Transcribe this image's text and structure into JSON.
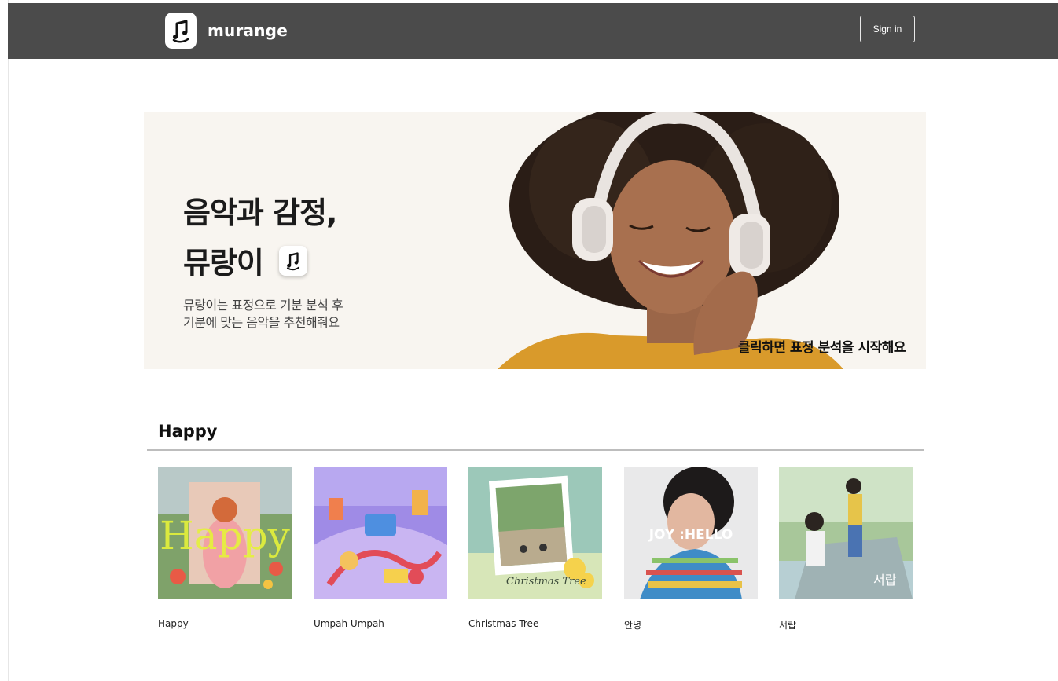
{
  "header": {
    "brand": "murange",
    "signin_label": "Sign in"
  },
  "hero": {
    "title_line1": "음악과 감정,",
    "title_line2": "뮤랑이",
    "desc_line1": "뮤랑이는 표정으로 기분 분석 후",
    "desc_line2": "기분에 맞는 음악을 추천해줘요",
    "cta": "클릭하면 표정 분석을 시작해요"
  },
  "section": {
    "title": "Happy",
    "albums": [
      {
        "title": "Happy",
        "cover_text": "Happy"
      },
      {
        "title": "Umpah Umpah"
      },
      {
        "title": "Christmas Tree",
        "cover_text": "Christmas Tree"
      },
      {
        "title": "안녕",
        "cover_text": "JOY :HELLO"
      },
      {
        "title": "서랍",
        "cover_text": "서랍"
      }
    ]
  },
  "icons": {
    "logo": "music-note-smile-icon"
  },
  "colors": {
    "header_bg": "#4b4b4b",
    "hero_bg": "#f8f5f0",
    "divider": "#bdbdbd"
  }
}
